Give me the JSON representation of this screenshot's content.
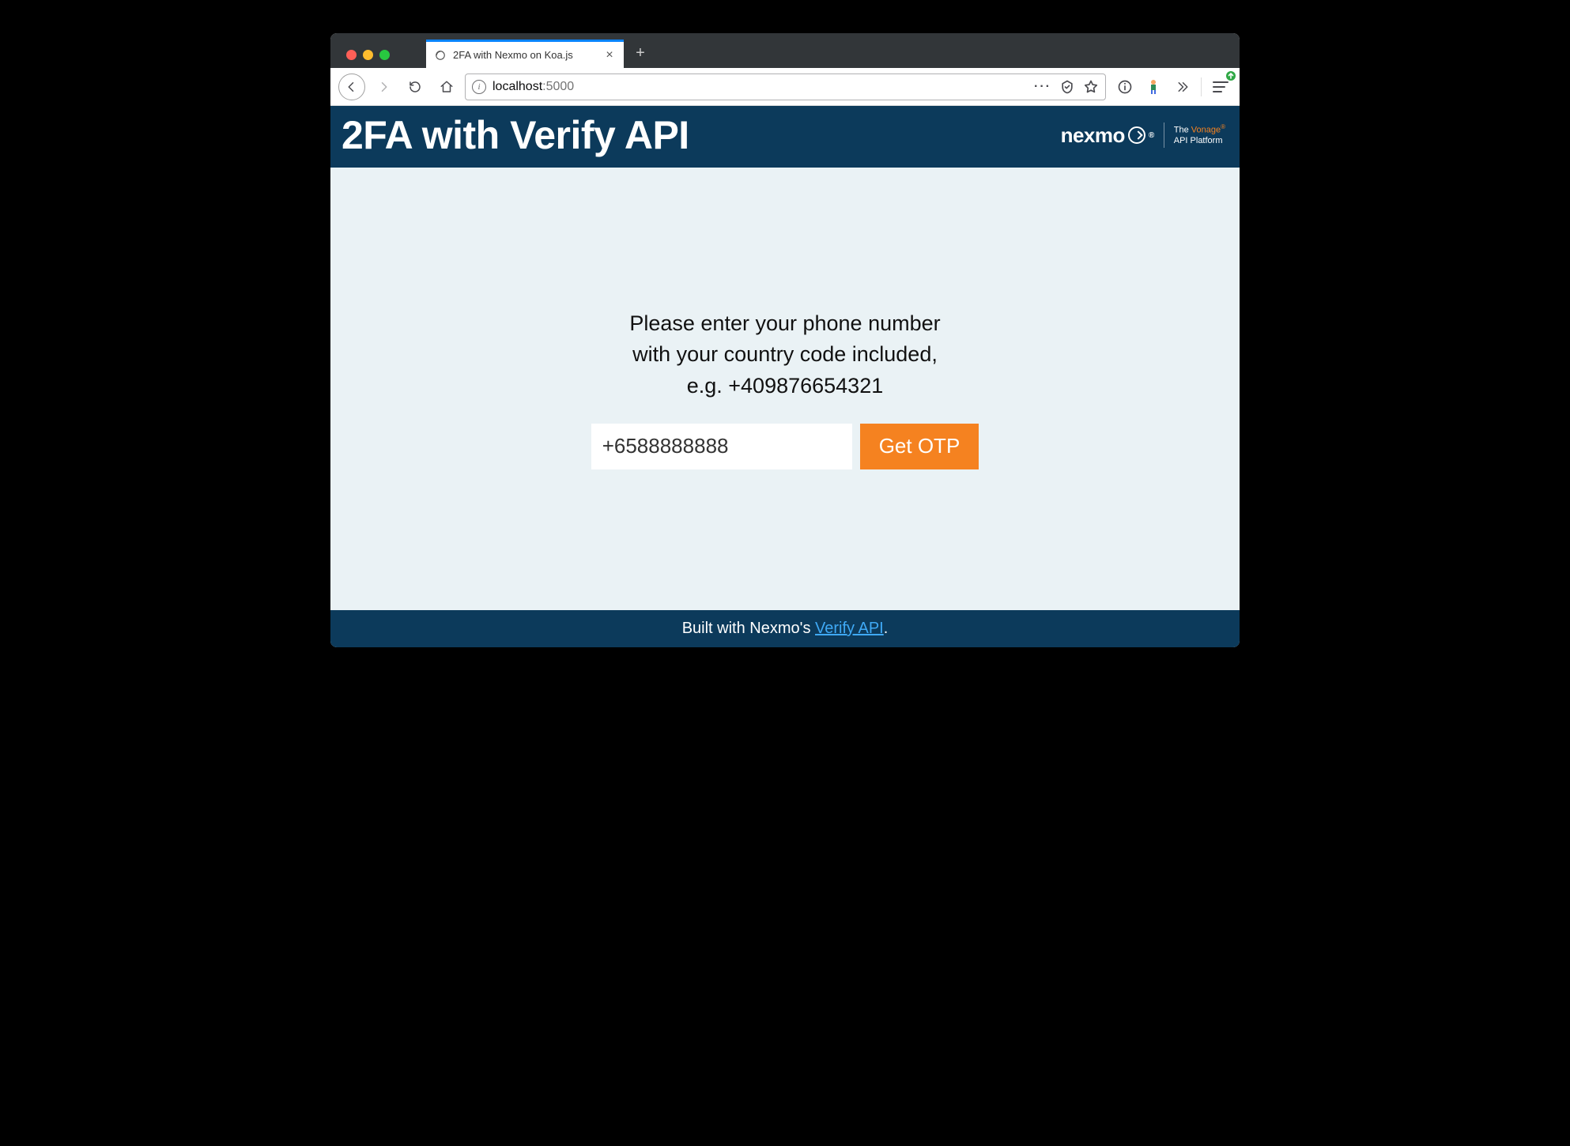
{
  "browser": {
    "tab": {
      "title": "2FA with Nexmo on Koa.js"
    },
    "address": {
      "host": "localhost",
      "port": ":5000"
    }
  },
  "header": {
    "title": "2FA with Verify API",
    "brand_name": "nexmo",
    "brand_reg": "®",
    "tagline_pre": "The ",
    "tagline_accent": "Vonage",
    "tagline_accent_reg": "®",
    "tagline_post": "API Platform"
  },
  "content": {
    "instruction_l1": "Please enter your phone number",
    "instruction_l2": "with your country code included,",
    "instruction_l3": "e.g. +409876654321",
    "phone_value": "+6588888888",
    "button_label": "Get OTP"
  },
  "footer": {
    "prefix": "Built with Nexmo's ",
    "link_text": "Verify API",
    "suffix": "."
  }
}
